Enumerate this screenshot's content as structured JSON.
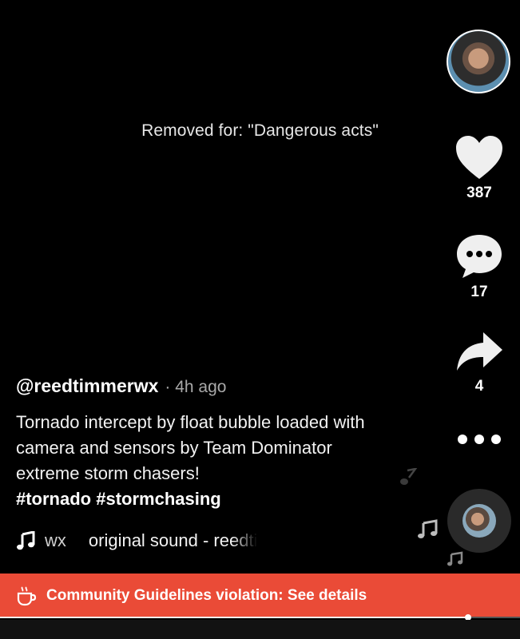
{
  "video": {
    "removed_notice": "Removed for: \"Dangerous acts\"",
    "progress_fraction": 0.9
  },
  "side_actions": {
    "likes": "387",
    "comments": "17",
    "shares": "4"
  },
  "post": {
    "username": "@reedtimmerwx",
    "time": "· 4h ago",
    "description": "Tornado intercept by float bubble loaded with camera and sensors by Team Dominator extreme storm chasers!",
    "hashtags": "#tornado #stormchasing",
    "sound_scroll_fragment": "wx",
    "sound_title": "original sound - reedti"
  },
  "banner": {
    "text": "Community Guidelines violation: See details",
    "color": "#ea4b37"
  },
  "icons": [
    "profile-avatar",
    "heart-icon",
    "comment-icon",
    "share-icon",
    "more-dots-icon",
    "music-note-icon",
    "sound-disc",
    "coffee-cup-icon"
  ]
}
